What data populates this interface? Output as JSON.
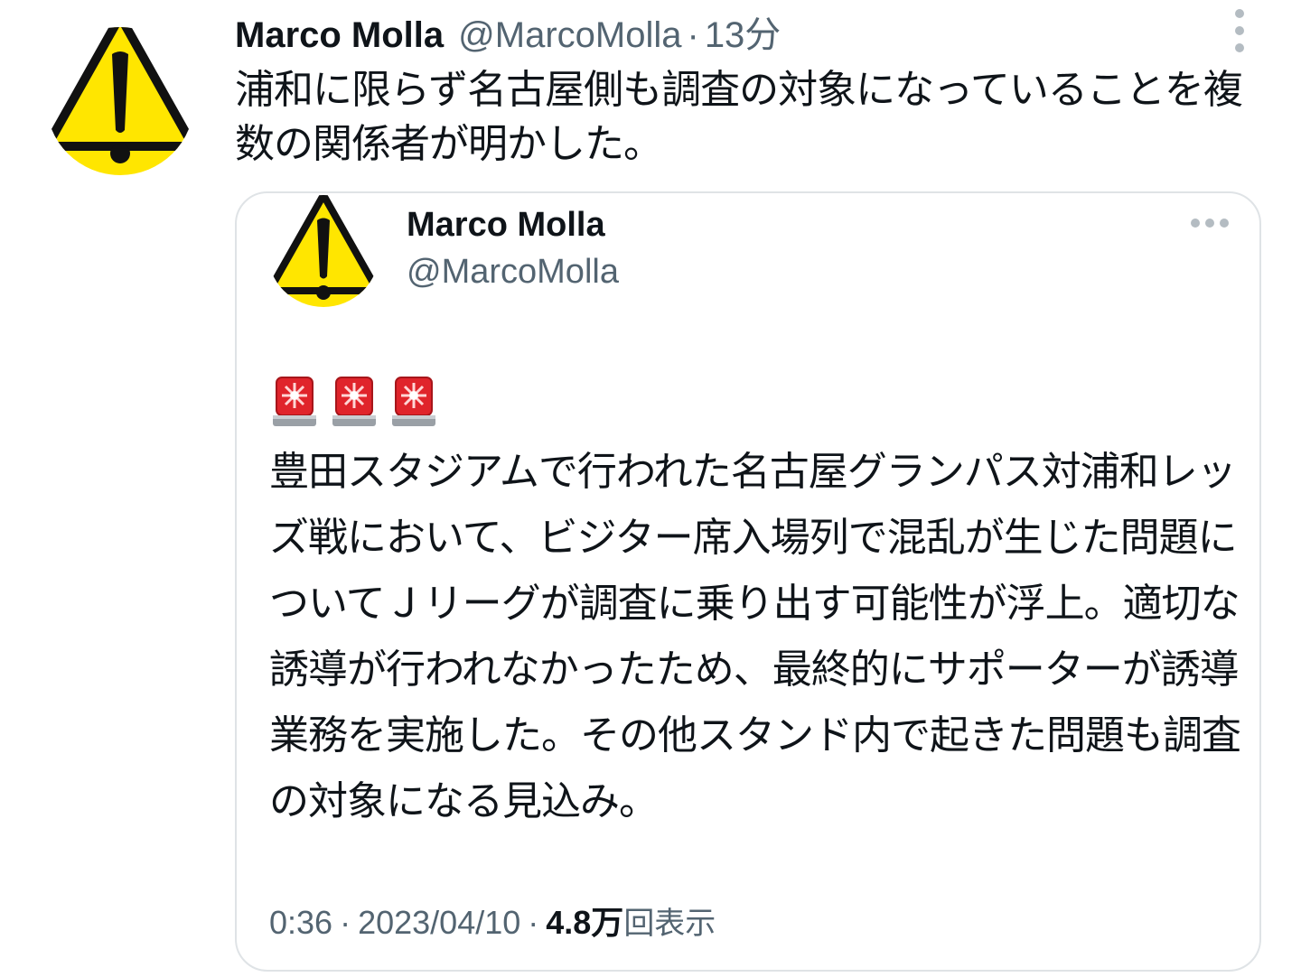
{
  "tweet": {
    "author": {
      "display_name": "Marco Molla",
      "handle": "@MarcoMolla",
      "avatar_icon": "warning-sign-icon"
    },
    "separator": "·",
    "time": "13分",
    "text": "浦和に限らず名古屋側も調査の対象になっていることを複数の関係者が明かした。",
    "more_icon": "more-vertical-icon"
  },
  "quote": {
    "author": {
      "display_name": "Marco Molla",
      "handle": "@MarcoMolla",
      "avatar_icon": "warning-sign-icon"
    },
    "more_icon": "more-horizontal-icon",
    "emoji": [
      "rotating-light-icon",
      "rotating-light-icon",
      "rotating-light-icon"
    ],
    "text": "豊田スタジアムで行われた名古屋グランパス対浦和レッズ戦において、ビジター席入場列で混乱が生じた問題についてＪリーグが調査に乗り出す可能性が浮上。適切な誘導が行われなかったため、最終的にサポーターが誘導業務を実施した。その他スタンド内で起きた問題も調査の対象になる見込み。",
    "time": "0:36",
    "date": "2023/04/10",
    "separator": "·",
    "views_count": "4.8万",
    "views_label": "回表示"
  },
  "colors": {
    "text_primary": "#0f1419",
    "text_secondary": "#536471",
    "border": "#dfe3e6",
    "warning_yellow": "#ffe600",
    "siren_red": "#e0242b"
  }
}
